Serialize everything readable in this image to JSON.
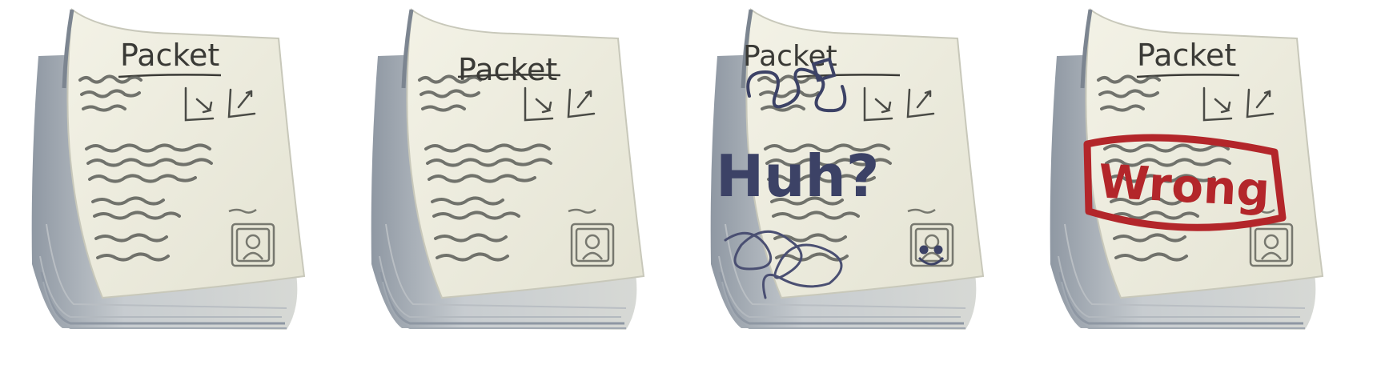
{
  "packets": [
    {
      "title": "Packet",
      "overlay": ""
    },
    {
      "title": "Packet",
      "overlay": ""
    },
    {
      "title": "Packet",
      "overlay": "Huh?"
    },
    {
      "title": "Packet",
      "overlay": "Wrong"
    }
  ],
  "colors": {
    "paper": "#efeee0",
    "paper_edge": "#c9ccc9",
    "stack_shadow": "#9aa2ab",
    "ink": "#3a3a36",
    "scribble": "#5a5f7a",
    "doodle": "#3c4266",
    "stamp_red": "#b3262a"
  }
}
